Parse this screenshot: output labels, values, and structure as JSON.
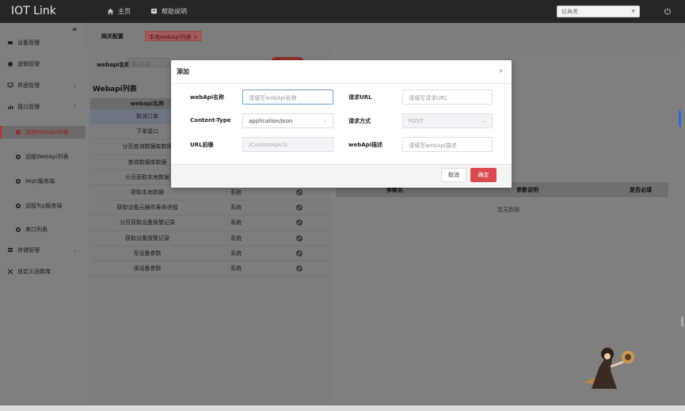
{
  "app": {
    "title": "IOT Link"
  },
  "topnav": {
    "home_label": "主页",
    "help_label": "帮助说明",
    "theme_value": "经典黑"
  },
  "sidebar": {
    "items": [
      {
        "label": "设备管理"
      },
      {
        "label": "逻辑管理"
      },
      {
        "label": "界面管理"
      },
      {
        "label": "接口管理"
      },
      {
        "label": "本地WebApi列表"
      },
      {
        "label": "远程WebApi列表"
      },
      {
        "label": "Mqtt服务端"
      },
      {
        "label": "远程Tcp服务端"
      },
      {
        "label": "串口列表"
      },
      {
        "label": "存储管理"
      },
      {
        "label": "自定义函数库"
      }
    ]
  },
  "tabs": {
    "tab1": "网关配置",
    "tab2": "本地webApi列表",
    "tab2_close": "×"
  },
  "search": {
    "label": "webapi名称:",
    "placeholder": "输入内容"
  },
  "list": {
    "title": "Webapi列表",
    "header": "webapi名称",
    "rows": [
      {
        "name": "取消订单",
        "type": "",
        "ban": false
      },
      {
        "name": "下单接口",
        "type": "",
        "ban": false
      },
      {
        "name": "分页查询数据库数据",
        "type": "",
        "ban": false
      },
      {
        "name": "查询数据库数据",
        "type": "",
        "ban": false
      },
      {
        "name": "分页获取本地数据",
        "type": "",
        "ban": false
      },
      {
        "name": "获取本地数据",
        "type": "系统",
        "ban": true
      },
      {
        "name": "获取设备元器件寿命进程",
        "type": "系统",
        "ban": true
      },
      {
        "name": "分页获取设备报警记录",
        "type": "系统",
        "ban": true
      },
      {
        "name": "获取设备报警记录",
        "type": "系统",
        "ban": true
      },
      {
        "name": "写设备参数",
        "type": "系统",
        "ban": true
      },
      {
        "name": "读设备参数",
        "type": "系统",
        "ban": true
      }
    ]
  },
  "params": {
    "col1": "参数名",
    "col2": "参数说明",
    "col3": "是否必填",
    "empty": "暂无数据"
  },
  "dialog": {
    "title": "添加",
    "close": "×",
    "name_label": "webApi名称",
    "name_placeholder": "请填写webApi名称",
    "url_label": "请求URL",
    "url_placeholder": "请填写请求URL",
    "content_type_label": "Content-Type",
    "content_type_value": "application/json",
    "method_label": "请求方式",
    "method_value": "POST",
    "prefix_label": "URL前缀",
    "prefix_value": "/CustomApi/1/",
    "desc_label": "webApi描述",
    "desc_placeholder": "请填写webApi描述",
    "cancel": "取消",
    "ok": "确定"
  },
  "colors": {
    "accent": "#d9494f",
    "topbar": "#262626",
    "overlay": "#808080"
  }
}
